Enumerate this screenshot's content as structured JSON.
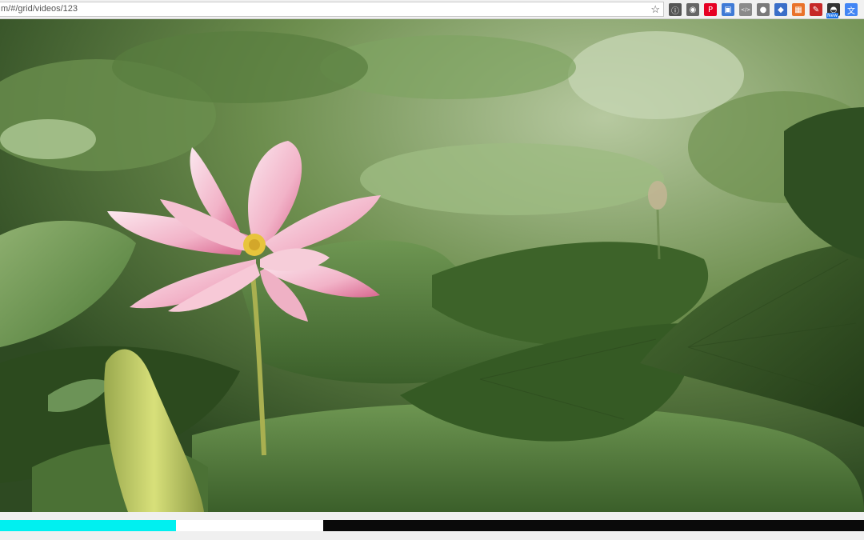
{
  "address_bar": {
    "url": "m/#/grid/videos/123",
    "bookmark_icon": "star-icon"
  },
  "extensions": [
    {
      "name": "info-icon",
      "glyph": "ⓘ",
      "color": "#555555"
    },
    {
      "name": "camera-icon",
      "glyph": "◉",
      "color": "#666666"
    },
    {
      "name": "pinterest-icon",
      "glyph": "P",
      "color": "#e60023"
    },
    {
      "name": "screen-capture-icon",
      "glyph": "▣",
      "color": "#3f7ad6"
    },
    {
      "name": "code-view-icon",
      "glyph": "</>",
      "color": "#8a8a8a"
    },
    {
      "name": "gear-icon",
      "glyph": "●",
      "color": "#7a7a7a"
    },
    {
      "name": "user-icon",
      "glyph": "◆",
      "color": "#3b6fc8"
    },
    {
      "name": "image-icon",
      "glyph": "▦",
      "color": "#e9722a"
    },
    {
      "name": "pdf-icon",
      "glyph": "✎",
      "color": "#c62828"
    },
    {
      "name": "new-extension-icon",
      "glyph": "◓",
      "color": "#333333",
      "badge": "New"
    },
    {
      "name": "translate-icon",
      "glyph": "文",
      "color": "#4285f4"
    }
  ],
  "video": {
    "progress": {
      "played_fraction": 0.204,
      "buffered_fraction": 0.374,
      "played_color": "#00f0f0",
      "buffered_color": "#ffffff",
      "track_color": "#0a0a0a"
    }
  }
}
